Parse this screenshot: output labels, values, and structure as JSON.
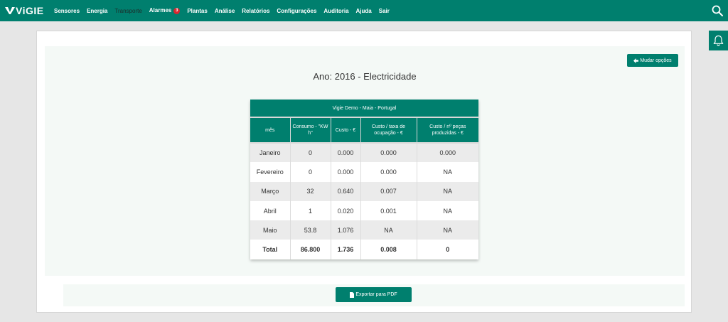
{
  "brand": {
    "name": "ViGIE",
    "accent": "#007f6e"
  },
  "nav": {
    "items": [
      {
        "label": "Sensores"
      },
      {
        "label": "Energia"
      },
      {
        "label": "Transporte",
        "active": true
      },
      {
        "label": "Alarmes",
        "badge": "3"
      },
      {
        "label": "Plantas"
      },
      {
        "label": "Análise"
      },
      {
        "label": "Relatórios"
      },
      {
        "label": "Configurações"
      },
      {
        "label": "Auditoria"
      },
      {
        "label": "Ajuda"
      },
      {
        "label": "Sair"
      }
    ],
    "search_icon": "search-icon"
  },
  "notifications": {
    "icon": "bell-icon"
  },
  "report": {
    "change_options_label": "Mudar opções",
    "title": "Ano: 2016 - Electricidade",
    "site": "Vigie Demo - Maia - Portugal",
    "columns": [
      "mês",
      "Consumo - \"KW h\"",
      "Custo - €",
      "Custo / taxa de ocupação - €",
      "Custo / nº peças produzidas - €"
    ],
    "rows": [
      [
        "Janeiro",
        "0",
        "0.000",
        "0.000",
        "0.000"
      ],
      [
        "Fevereiro",
        "0",
        "0.000",
        "0.000",
        "NA"
      ],
      [
        "Março",
        "32",
        "0.640",
        "0.007",
        "NA"
      ],
      [
        "Abril",
        "1",
        "0.020",
        "0.001",
        "NA"
      ],
      [
        "Maio",
        "53.8",
        "1.076",
        "NA",
        "NA"
      ]
    ],
    "total": [
      "Total",
      "86.800",
      "1.736",
      "0.008",
      "0"
    ],
    "export_label": "Exportar para PDF"
  }
}
